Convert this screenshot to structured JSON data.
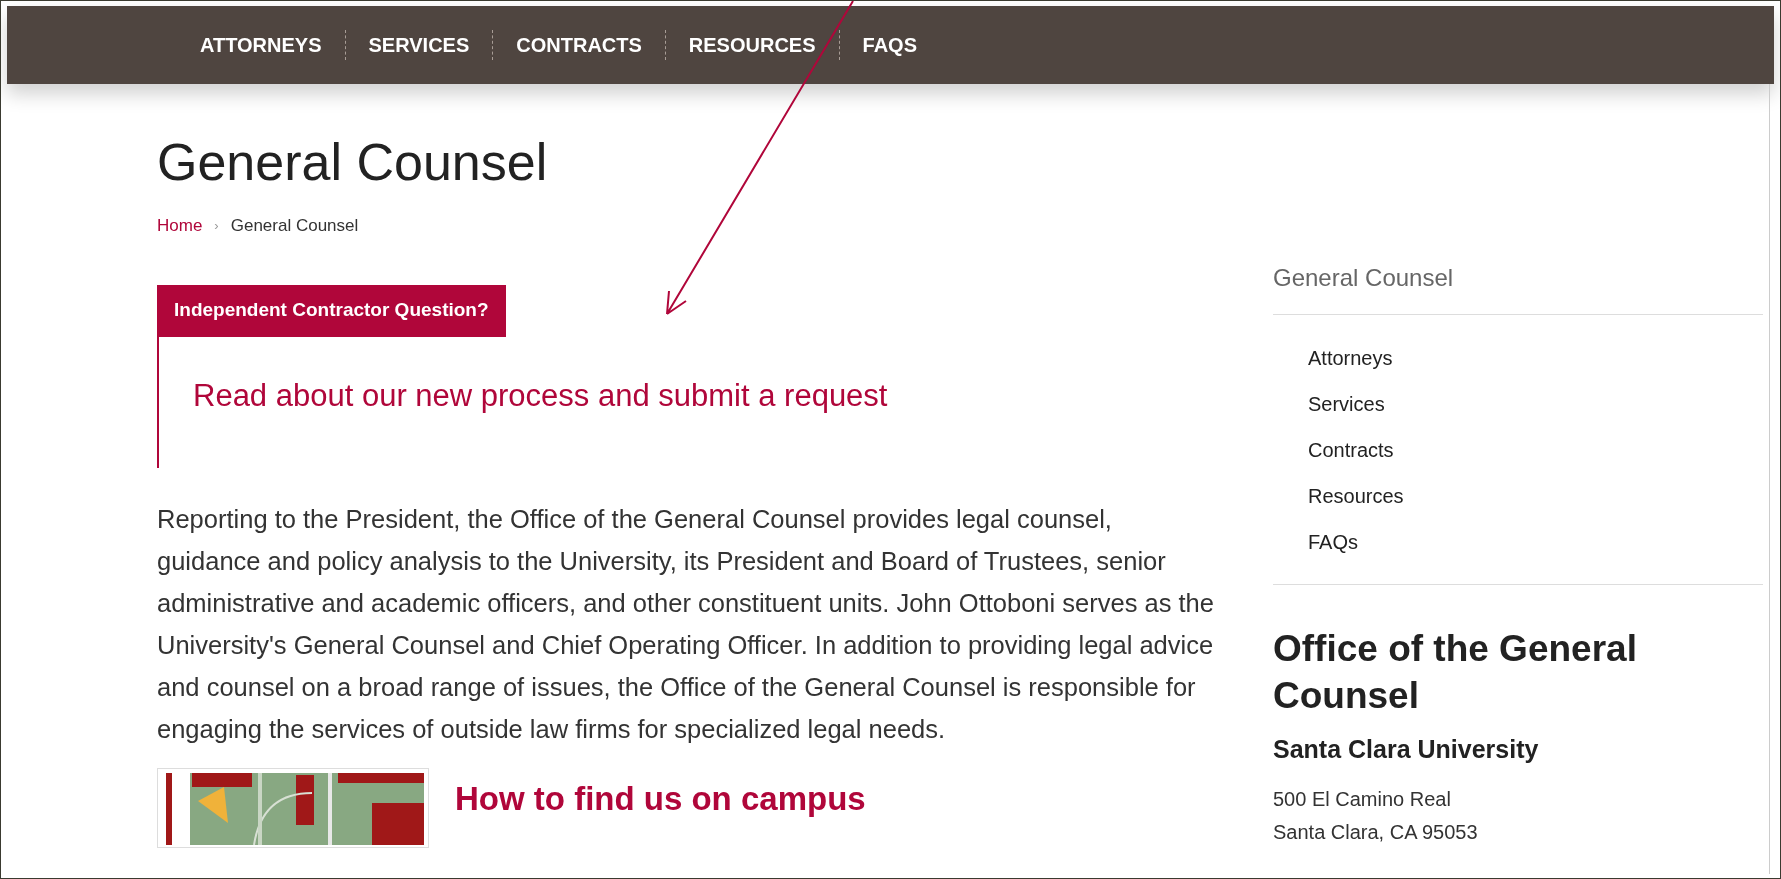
{
  "nav": {
    "items": [
      {
        "label": "ATTORNEYS"
      },
      {
        "label": "SERVICES"
      },
      {
        "label": "CONTRACTS"
      },
      {
        "label": "RESOURCES"
      },
      {
        "label": "FAQS"
      }
    ]
  },
  "page_title": "General Counsel",
  "breadcrumb": [
    {
      "label": "Home",
      "kind": "link"
    },
    {
      "label": "›",
      "kind": "separator"
    },
    {
      "label": "General Counsel",
      "kind": "current"
    }
  ],
  "callout": {
    "tab": "Independent Contractor Question?",
    "link": "Read about our new process and submit a request"
  },
  "intro": "Reporting to the President, the Office of the General Counsel provides legal counsel, guidance and policy analysis to the University, its President and Board of Trustees, senior administrative and academic officers, and other constituent units. John Ottoboni serves as the University's General Counsel and Chief Operating Officer. In addition to providing legal advice and counsel on a broad range of issues, the Office of the General Counsel is responsible for engaging the services of outside law firms for specialized legal needs.",
  "campus": {
    "heading": "How to find us on campus"
  },
  "sidebar": {
    "title": "General Counsel",
    "items": [
      {
        "label": "Attorneys"
      },
      {
        "label": "Services"
      },
      {
        "label": "Contracts"
      },
      {
        "label": "Resources"
      },
      {
        "label": "FAQs"
      }
    ],
    "office": {
      "heading": "Office of the General Counsel",
      "university": "Santa Clara University",
      "address": [
        "500 El Camino Real",
        "Santa Clara, CA 95053"
      ]
    }
  }
}
